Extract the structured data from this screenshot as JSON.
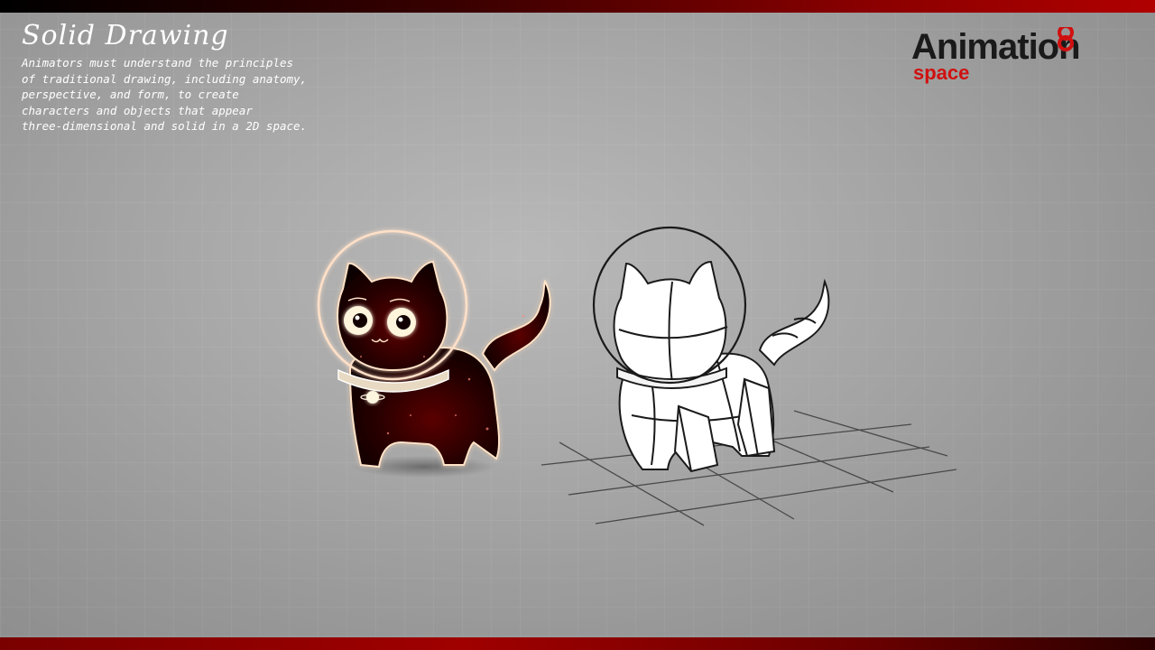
{
  "slide": {
    "title": "Solid Drawing",
    "description_lines": [
      "Animators must understand the principles",
      "of traditional drawing, including anatomy,",
      "perspective, and form, to create",
      "characters and objects that appear",
      "three-dimensional and solid in a 2D space."
    ]
  },
  "logo": {
    "main_text": "Animation",
    "sub_text": "space",
    "brand_color": "#d01010",
    "text_color": "#1a1a1a"
  },
  "colors": {
    "accent": "#b00000",
    "background": "#a9a9a9",
    "glow": "#ffd2b0"
  },
  "illustrations": {
    "left": "space-cat-rendered",
    "right": "space-cat-construction-sketch"
  }
}
